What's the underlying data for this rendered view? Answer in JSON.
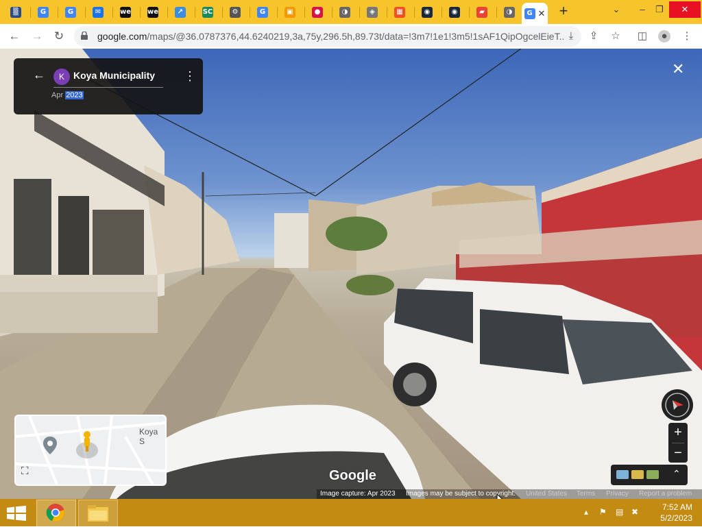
{
  "browser": {
    "tabs": [
      {
        "icon": "qr-icon",
        "color": "#2b4a8a",
        "glyph": "▒"
      },
      {
        "icon": "google-icon",
        "color": "#4285f4",
        "glyph": "G"
      },
      {
        "icon": "google-icon",
        "color": "#4285f4",
        "glyph": "G"
      },
      {
        "icon": "email-icon",
        "color": "#1a73e8",
        "glyph": "✉"
      },
      {
        "icon": "we-icon",
        "color": "#111111",
        "glyph": "we"
      },
      {
        "icon": "we-icon",
        "color": "#111111",
        "glyph": "we"
      },
      {
        "icon": "chart-icon",
        "color": "#3c8dde",
        "glyph": "↗"
      },
      {
        "icon": "sc-icon",
        "color": "#1b8a5a",
        "glyph": "SC"
      },
      {
        "icon": "gear-icon",
        "color": "#555555",
        "glyph": "⚙"
      },
      {
        "icon": "google-icon",
        "color": "#4285f4",
        "glyph": "G"
      },
      {
        "icon": "map-tab-icon",
        "color": "#f29900",
        "glyph": "▣"
      },
      {
        "icon": "record-icon",
        "color": "#d8114b",
        "glyph": "●"
      },
      {
        "icon": "globe-icon",
        "color": "#666666",
        "glyph": "◑"
      },
      {
        "icon": "shield-icon",
        "color": "#777777",
        "glyph": "◈"
      },
      {
        "icon": "microsoft-icon",
        "color": "#f25022",
        "glyph": "▦"
      },
      {
        "icon": "steam-icon",
        "color": "#1b2838",
        "glyph": "◉"
      },
      {
        "icon": "steam-icon",
        "color": "#1b2838",
        "glyph": "◉"
      },
      {
        "icon": "maps-icon",
        "color": "#ea4335",
        "glyph": "▰"
      },
      {
        "icon": "globe-icon",
        "color": "#666666",
        "glyph": "◑"
      }
    ],
    "active_tab": {
      "icon": "google-icon",
      "close": "✕"
    },
    "new_tab": "+",
    "window": {
      "dropdown": "⌄",
      "minimize": "–",
      "restore": "❐",
      "close": "✕"
    },
    "nav": {
      "back": "←",
      "forward": "→",
      "reload": "↻"
    },
    "url_host": "google.com",
    "url_path": "/maps/@36.0787376,44.6240219,3a,75y,296.5h,89.73t/data=!3m7!1e1!3m5!1sAF1QipOgcelEieT..."
  },
  "streetview": {
    "card": {
      "back": "←",
      "avatar_letter": "K",
      "title": "Koya Municipality",
      "date_month": "Apr ",
      "date_year": "2023",
      "menu": "⋮"
    },
    "close": "✕",
    "minimap_label": "Koya S",
    "expand": "⛶",
    "zoom_in": "+",
    "zoom_out": "−",
    "layers_chevron": "⌃",
    "logo": "Google",
    "footer": {
      "capture": "Image capture: Apr 2023",
      "copyright": "Images may be subject to copyright.",
      "country": "United States",
      "terms": "Terms",
      "privacy": "Privacy",
      "report": "Report a problem"
    }
  },
  "taskbar": {
    "time": "7:52 AM",
    "date": "5/2/2023",
    "tray_up": "▴"
  }
}
